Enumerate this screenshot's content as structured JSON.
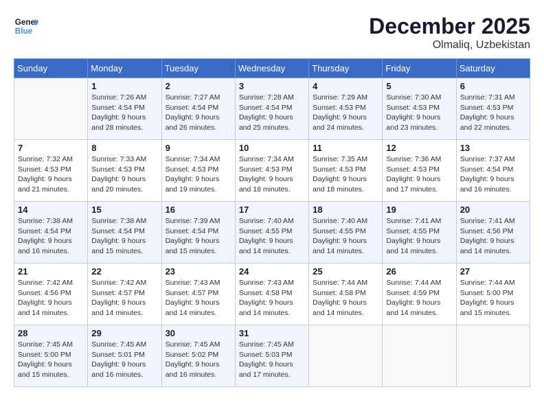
{
  "header": {
    "logo_line1": "General",
    "logo_line2": "Blue",
    "month": "December 2025",
    "location": "Olmaliq, Uzbekistan"
  },
  "weekdays": [
    "Sunday",
    "Monday",
    "Tuesday",
    "Wednesday",
    "Thursday",
    "Friday",
    "Saturday"
  ],
  "weeks": [
    [
      {
        "day": "",
        "sunrise": "",
        "sunset": "",
        "daylight": ""
      },
      {
        "day": "1",
        "sunrise": "Sunrise: 7:26 AM",
        "sunset": "Sunset: 4:54 PM",
        "daylight": "Daylight: 9 hours and 28 minutes."
      },
      {
        "day": "2",
        "sunrise": "Sunrise: 7:27 AM",
        "sunset": "Sunset: 4:54 PM",
        "daylight": "Daylight: 9 hours and 26 minutes."
      },
      {
        "day": "3",
        "sunrise": "Sunrise: 7:28 AM",
        "sunset": "Sunset: 4:54 PM",
        "daylight": "Daylight: 9 hours and 25 minutes."
      },
      {
        "day": "4",
        "sunrise": "Sunrise: 7:29 AM",
        "sunset": "Sunset: 4:53 PM",
        "daylight": "Daylight: 9 hours and 24 minutes."
      },
      {
        "day": "5",
        "sunrise": "Sunrise: 7:30 AM",
        "sunset": "Sunset: 4:53 PM",
        "daylight": "Daylight: 9 hours and 23 minutes."
      },
      {
        "day": "6",
        "sunrise": "Sunrise: 7:31 AM",
        "sunset": "Sunset: 4:53 PM",
        "daylight": "Daylight: 9 hours and 22 minutes."
      }
    ],
    [
      {
        "day": "7",
        "sunrise": "Sunrise: 7:32 AM",
        "sunset": "Sunset: 4:53 PM",
        "daylight": "Daylight: 9 hours and 21 minutes."
      },
      {
        "day": "8",
        "sunrise": "Sunrise: 7:33 AM",
        "sunset": "Sunset: 4:53 PM",
        "daylight": "Daylight: 9 hours and 20 minutes."
      },
      {
        "day": "9",
        "sunrise": "Sunrise: 7:34 AM",
        "sunset": "Sunset: 4:53 PM",
        "daylight": "Daylight: 9 hours and 19 minutes."
      },
      {
        "day": "10",
        "sunrise": "Sunrise: 7:34 AM",
        "sunset": "Sunset: 4:53 PM",
        "daylight": "Daylight: 9 hours and 18 minutes."
      },
      {
        "day": "11",
        "sunrise": "Sunrise: 7:35 AM",
        "sunset": "Sunset: 4:53 PM",
        "daylight": "Daylight: 9 hours and 18 minutes."
      },
      {
        "day": "12",
        "sunrise": "Sunrise: 7:36 AM",
        "sunset": "Sunset: 4:53 PM",
        "daylight": "Daylight: 9 hours and 17 minutes."
      },
      {
        "day": "13",
        "sunrise": "Sunrise: 7:37 AM",
        "sunset": "Sunset: 4:54 PM",
        "daylight": "Daylight: 9 hours and 16 minutes."
      }
    ],
    [
      {
        "day": "14",
        "sunrise": "Sunrise: 7:38 AM",
        "sunset": "Sunset: 4:54 PM",
        "daylight": "Daylight: 9 hours and 16 minutes."
      },
      {
        "day": "15",
        "sunrise": "Sunrise: 7:38 AM",
        "sunset": "Sunset: 4:54 PM",
        "daylight": "Daylight: 9 hours and 15 minutes."
      },
      {
        "day": "16",
        "sunrise": "Sunrise: 7:39 AM",
        "sunset": "Sunset: 4:54 PM",
        "daylight": "Daylight: 9 hours and 15 minutes."
      },
      {
        "day": "17",
        "sunrise": "Sunrise: 7:40 AM",
        "sunset": "Sunset: 4:55 PM",
        "daylight": "Daylight: 9 hours and 14 minutes."
      },
      {
        "day": "18",
        "sunrise": "Sunrise: 7:40 AM",
        "sunset": "Sunset: 4:55 PM",
        "daylight": "Daylight: 9 hours and 14 minutes."
      },
      {
        "day": "19",
        "sunrise": "Sunrise: 7:41 AM",
        "sunset": "Sunset: 4:55 PM",
        "daylight": "Daylight: 9 hours and 14 minutes."
      },
      {
        "day": "20",
        "sunrise": "Sunrise: 7:41 AM",
        "sunset": "Sunset: 4:56 PM",
        "daylight": "Daylight: 9 hours and 14 minutes."
      }
    ],
    [
      {
        "day": "21",
        "sunrise": "Sunrise: 7:42 AM",
        "sunset": "Sunset: 4:56 PM",
        "daylight": "Daylight: 9 hours and 14 minutes."
      },
      {
        "day": "22",
        "sunrise": "Sunrise: 7:42 AM",
        "sunset": "Sunset: 4:57 PM",
        "daylight": "Daylight: 9 hours and 14 minutes."
      },
      {
        "day": "23",
        "sunrise": "Sunrise: 7:43 AM",
        "sunset": "Sunset: 4:57 PM",
        "daylight": "Daylight: 9 hours and 14 minutes."
      },
      {
        "day": "24",
        "sunrise": "Sunrise: 7:43 AM",
        "sunset": "Sunset: 4:58 PM",
        "daylight": "Daylight: 9 hours and 14 minutes."
      },
      {
        "day": "25",
        "sunrise": "Sunrise: 7:44 AM",
        "sunset": "Sunset: 4:58 PM",
        "daylight": "Daylight: 9 hours and 14 minutes."
      },
      {
        "day": "26",
        "sunrise": "Sunrise: 7:44 AM",
        "sunset": "Sunset: 4:59 PM",
        "daylight": "Daylight: 9 hours and 14 minutes."
      },
      {
        "day": "27",
        "sunrise": "Sunrise: 7:44 AM",
        "sunset": "Sunset: 5:00 PM",
        "daylight": "Daylight: 9 hours and 15 minutes."
      }
    ],
    [
      {
        "day": "28",
        "sunrise": "Sunrise: 7:45 AM",
        "sunset": "Sunset: 5:00 PM",
        "daylight": "Daylight: 9 hours and 15 minutes."
      },
      {
        "day": "29",
        "sunrise": "Sunrise: 7:45 AM",
        "sunset": "Sunset: 5:01 PM",
        "daylight": "Daylight: 9 hours and 16 minutes."
      },
      {
        "day": "30",
        "sunrise": "Sunrise: 7:45 AM",
        "sunset": "Sunset: 5:02 PM",
        "daylight": "Daylight: 9 hours and 16 minutes."
      },
      {
        "day": "31",
        "sunrise": "Sunrise: 7:45 AM",
        "sunset": "Sunset: 5:03 PM",
        "daylight": "Daylight: 9 hours and 17 minutes."
      },
      {
        "day": "",
        "sunrise": "",
        "sunset": "",
        "daylight": ""
      },
      {
        "day": "",
        "sunrise": "",
        "sunset": "",
        "daylight": ""
      },
      {
        "day": "",
        "sunrise": "",
        "sunset": "",
        "daylight": ""
      }
    ]
  ]
}
